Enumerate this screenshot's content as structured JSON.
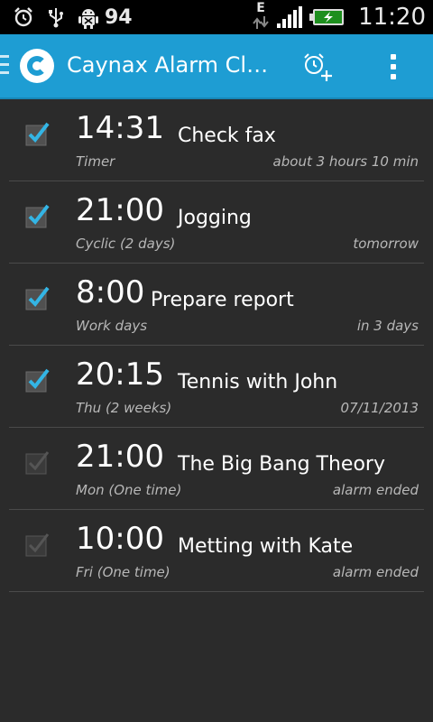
{
  "status_bar": {
    "icons": [
      "alarm-clock-icon",
      "usb-icon",
      "android-debug-icon"
    ],
    "badge_number": "94",
    "network_label": "E",
    "time": "11:20",
    "battery_color": "#1e8f1e"
  },
  "action_bar": {
    "title": "Caynax Alarm Cl…",
    "accent_color": "#1e9dd3"
  },
  "alarms": [
    {
      "time": "14:31",
      "label": "Check fax",
      "repeat": "Timer",
      "when": "about 3 hours 10 min",
      "enabled": true
    },
    {
      "time": "21:00",
      "label": "Jogging",
      "repeat": "Cyclic (2 days)",
      "when": "tomorrow",
      "enabled": true
    },
    {
      "time": "8:00",
      "label": "Prepare report",
      "repeat": "Work days",
      "when": "in 3 days",
      "enabled": true
    },
    {
      "time": "20:15",
      "label": "Tennis with John",
      "repeat": "Thu (2 weeks)",
      "when": "07/11/2013",
      "enabled": true
    },
    {
      "time": "21:00",
      "label": "The Big Bang Theory",
      "repeat": "Mon (One time)",
      "when": "alarm ended",
      "enabled": false
    },
    {
      "time": "10:00",
      "label": "Metting with Kate",
      "repeat": "Fri (One time)",
      "when": "alarm ended",
      "enabled": false
    }
  ]
}
